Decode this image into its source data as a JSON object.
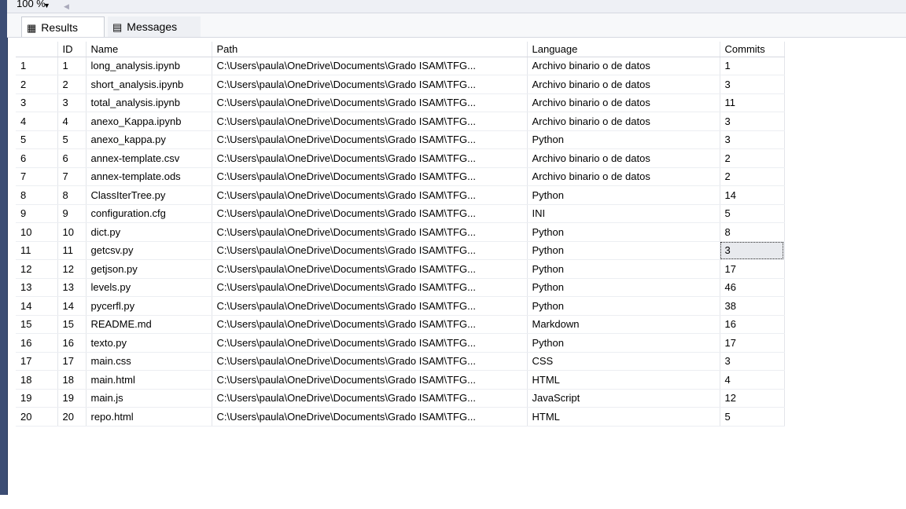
{
  "toolbar": {
    "zoom_value": "100 %"
  },
  "tabs": [
    {
      "label": "Results",
      "icon": "grid-icon"
    },
    {
      "label": "Messages",
      "icon": "messages-icon"
    }
  ],
  "grid": {
    "columns": [
      "",
      "ID",
      "Name",
      "Path",
      "Language",
      "Commits"
    ],
    "rows": [
      [
        "1",
        "1",
        "long_analysis.ipynb",
        "C:\\Users\\paula\\OneDrive\\Documents\\Grado ISAM\\TFG...",
        "Archivo binario o de datos",
        "1"
      ],
      [
        "2",
        "2",
        "short_analysis.ipynb",
        "C:\\Users\\paula\\OneDrive\\Documents\\Grado ISAM\\TFG...",
        "Archivo binario o de datos",
        "3"
      ],
      [
        "3",
        "3",
        "total_analysis.ipynb",
        "C:\\Users\\paula\\OneDrive\\Documents\\Grado ISAM\\TFG...",
        "Archivo binario o de datos",
        "11"
      ],
      [
        "4",
        "4",
        "anexo_Kappa.ipynb",
        "C:\\Users\\paula\\OneDrive\\Documents\\Grado ISAM\\TFG...",
        "Archivo binario o de datos",
        "3"
      ],
      [
        "5",
        "5",
        "anexo_kappa.py",
        "C:\\Users\\paula\\OneDrive\\Documents\\Grado ISAM\\TFG...",
        "Python",
        "3"
      ],
      [
        "6",
        "6",
        "annex-template.csv",
        "C:\\Users\\paula\\OneDrive\\Documents\\Grado ISAM\\TFG...",
        "Archivo binario o de datos",
        "2"
      ],
      [
        "7",
        "7",
        "annex-template.ods",
        "C:\\Users\\paula\\OneDrive\\Documents\\Grado ISAM\\TFG...",
        "Archivo binario o de datos",
        "2"
      ],
      [
        "8",
        "8",
        "ClassIterTree.py",
        "C:\\Users\\paula\\OneDrive\\Documents\\Grado ISAM\\TFG...",
        "Python",
        "14"
      ],
      [
        "9",
        "9",
        "configuration.cfg",
        "C:\\Users\\paula\\OneDrive\\Documents\\Grado ISAM\\TFG...",
        "INI",
        "5"
      ],
      [
        "10",
        "10",
        "dict.py",
        "C:\\Users\\paula\\OneDrive\\Documents\\Grado ISAM\\TFG...",
        "Python",
        "8"
      ],
      [
        "11",
        "11",
        "getcsv.py",
        "C:\\Users\\paula\\OneDrive\\Documents\\Grado ISAM\\TFG...",
        "Python",
        "3"
      ],
      [
        "12",
        "12",
        "getjson.py",
        "C:\\Users\\paula\\OneDrive\\Documents\\Grado ISAM\\TFG...",
        "Python",
        "17"
      ],
      [
        "13",
        "13",
        "levels.py",
        "C:\\Users\\paula\\OneDrive\\Documents\\Grado ISAM\\TFG...",
        "Python",
        "46"
      ],
      [
        "14",
        "14",
        "pycerfl.py",
        "C:\\Users\\paula\\OneDrive\\Documents\\Grado ISAM\\TFG...",
        "Python",
        "38"
      ],
      [
        "15",
        "15",
        "README.md",
        "C:\\Users\\paula\\OneDrive\\Documents\\Grado ISAM\\TFG...",
        "Markdown",
        "16"
      ],
      [
        "16",
        "16",
        "texto.py",
        "C:\\Users\\paula\\OneDrive\\Documents\\Grado ISAM\\TFG...",
        "Python",
        "17"
      ],
      [
        "17",
        "17",
        "main.css",
        "C:\\Users\\paula\\OneDrive\\Documents\\Grado ISAM\\TFG...",
        "CSS",
        "3"
      ],
      [
        "18",
        "18",
        "main.html",
        "C:\\Users\\paula\\OneDrive\\Documents\\Grado ISAM\\TFG...",
        "HTML",
        "4"
      ],
      [
        "19",
        "19",
        "main.js",
        "C:\\Users\\paula\\OneDrive\\Documents\\Grado ISAM\\TFG...",
        "JavaScript",
        "12"
      ],
      [
        "20",
        "20",
        "repo.html",
        "C:\\Users\\paula\\OneDrive\\Documents\\Grado ISAM\\TFG...",
        "HTML",
        "5"
      ]
    ],
    "selected_row": 11,
    "selected_col": 5
  }
}
